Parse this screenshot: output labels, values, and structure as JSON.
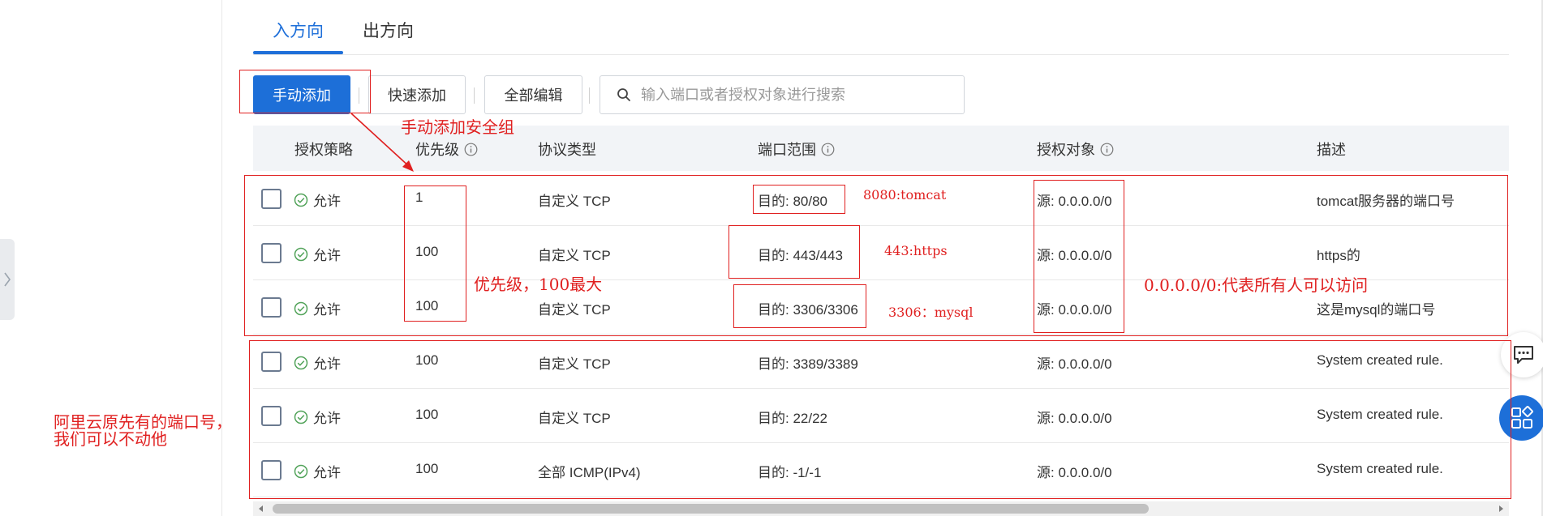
{
  "tabs": [
    {
      "label": "入方向",
      "active": true
    },
    {
      "label": "出方向",
      "active": false
    }
  ],
  "toolbar": {
    "manual_add": "手动添加",
    "quick_add": "快速添加",
    "edit_all": "全部编辑",
    "search_placeholder": "输入端口或者授权对象进行搜索"
  },
  "table": {
    "headers": {
      "policy": "授权策略",
      "priority": "优先级",
      "protocol": "协议类型",
      "port_range": "端口范围",
      "auth_object": "授权对象",
      "description": "描述"
    },
    "rows": [
      {
        "policy": "允许",
        "priority": "1",
        "protocol": "自定义 TCP",
        "port": "目的: 80/80",
        "source": "源: 0.0.0.0/0",
        "desc": "tomcat服务器的端口号"
      },
      {
        "policy": "允许",
        "priority": "100",
        "protocol": "自定义 TCP",
        "port": "目的: 443/443",
        "source": "源: 0.0.0.0/0",
        "desc": "https的"
      },
      {
        "policy": "允许",
        "priority": "100",
        "protocol": "自定义 TCP",
        "port": "目的: 3306/3306",
        "source": "源: 0.0.0.0/0",
        "desc": "这是mysql的端口号"
      },
      {
        "policy": "允许",
        "priority": "100",
        "protocol": "自定义 TCP",
        "port": "目的: 3389/3389",
        "source": "源: 0.0.0.0/0",
        "desc": "System created rule."
      },
      {
        "policy": "允许",
        "priority": "100",
        "protocol": "自定义 TCP",
        "port": "目的: 22/22",
        "source": "源: 0.0.0.0/0",
        "desc": "System created rule."
      },
      {
        "policy": "允许",
        "priority": "100",
        "protocol": "全部 ICMP(IPv4)",
        "port": "目的: -1/-1",
        "source": "源: 0.0.0.0/0",
        "desc": "System created rule."
      }
    ]
  },
  "annotations": {
    "manual_add_note": "手动添加安全组",
    "tomcat_note": "8080:tomcat",
    "https_note": "443:https",
    "priority_note": "优先级，100最大",
    "mysql_note": "3306：mysql",
    "source_note": "0.0.0.0/0:代表所有人可以访问",
    "aliyun_note_line1": "阿里云原先有的端口号，",
    "aliyun_note_line2": "我们可以不动他"
  },
  "colors": {
    "accent": "#1d6fd8",
    "annotation": "#e02020",
    "allow_green": "#52a35a"
  },
  "icons": {
    "search": "search-icon",
    "info": "info-icon",
    "allow": "check-circle-icon",
    "chat": "chat-icon",
    "apps": "apps-icon",
    "collapse": "chevron-right-icon"
  }
}
